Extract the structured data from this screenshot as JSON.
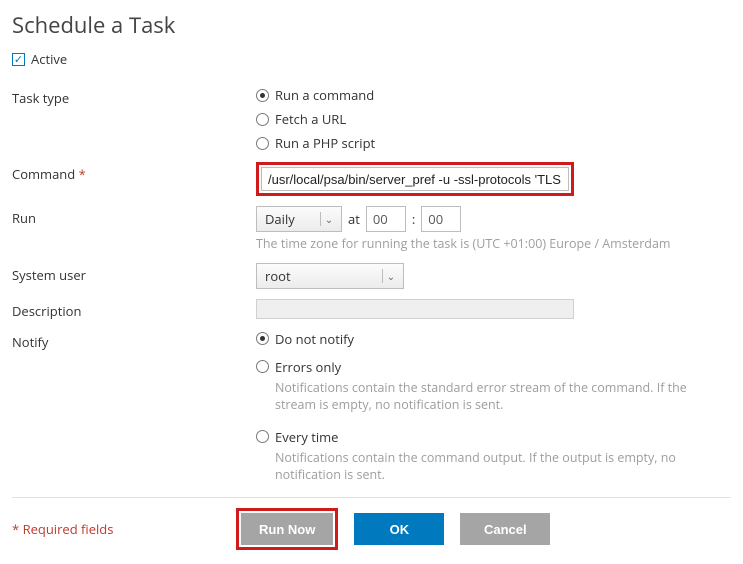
{
  "title": "Schedule a Task",
  "active_label": "Active",
  "labels": {
    "task_type": "Task type",
    "command": "Command",
    "run": "Run",
    "system_user": "System user",
    "description": "Description",
    "notify": "Notify"
  },
  "required_marker": "*",
  "task_type_options": {
    "run_command": "Run a command",
    "fetch_url": "Fetch a URL",
    "run_php": "Run a PHP script"
  },
  "command_value": "/usr/local/psa/bin/server_pref -u -ssl-protocols 'TLS",
  "run": {
    "freq": "Daily",
    "at_label": "at",
    "colon": ":",
    "hour": "00",
    "minute": "00",
    "tz_hint": "The time zone for running the task is (UTC +01:00) Europe / Amsterdam"
  },
  "system_user_value": "root",
  "notify": {
    "do_not": "Do not notify",
    "errors_only": "Errors only",
    "errors_hint": "Notifications contain the standard error stream of the command. If the stream is empty, no notification is sent.",
    "every_time": "Every time",
    "every_hint": "Notifications contain the command output. If the output is empty, no notification is sent."
  },
  "footer": {
    "required_note": "Required fields",
    "run_now": "Run Now",
    "ok": "OK",
    "cancel": "Cancel"
  },
  "icons": {
    "chevron": "⌄"
  }
}
